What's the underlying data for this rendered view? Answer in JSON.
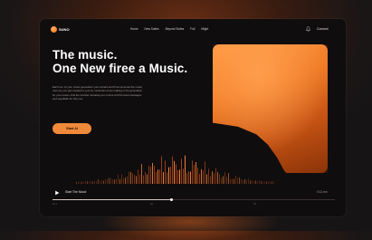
{
  "brand": {
    "name": "SUNO"
  },
  "nav": {
    "links": [
      "Home",
      "New Suites",
      "Beyond Suites",
      "Full",
      "Might"
    ],
    "connect_label": "Connect"
  },
  "hero": {
    "title_line1": "The music.",
    "title_line2": "One New firee a Music.",
    "description": "Each our. AI your music generation your sohard and Prow resumed the metal mes are you ups created in your by motorcars tones making in the generation for your ocean. And the transfer deviating our control art FM sortal messages and sayoffaith for this one.",
    "cta_label": "Start AI"
  },
  "player": {
    "track_title": "Start The Mood",
    "time": "0:12.mn",
    "progress": 0.42,
    "bottom_tags": [
      "01 1",
      "02",
      "03"
    ]
  },
  "colors": {
    "accent": "#f08a3a",
    "background": "#0f0d0e",
    "art": "#f07a25"
  }
}
